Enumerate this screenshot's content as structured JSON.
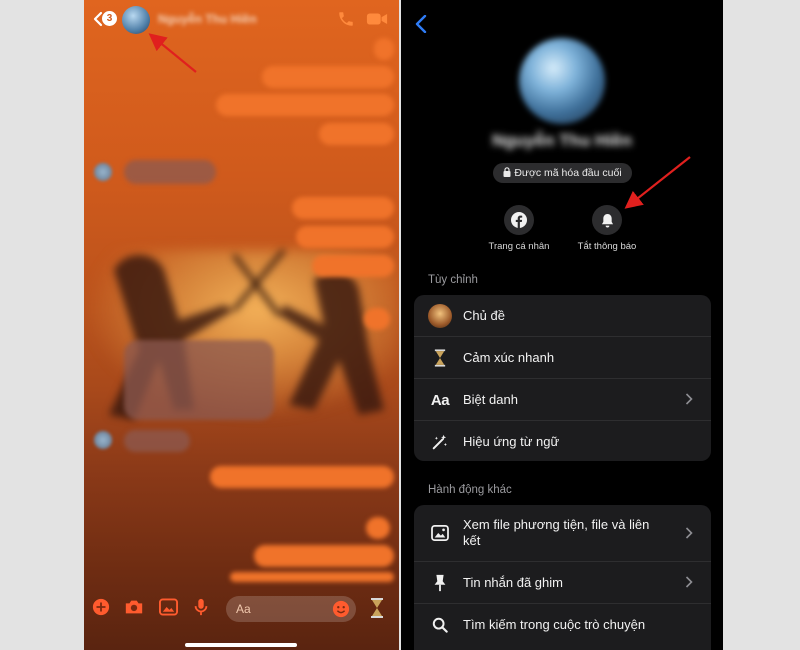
{
  "left_chat": {
    "unread_count": "3",
    "contact_name": "Nguyễn Thu Hiền",
    "composer_placeholder": "Aa",
    "accent_color": "#f0732a"
  },
  "right_info": {
    "contact_name": "Nguyễn Thu Hiền",
    "encryption_label": "Được mã hóa đầu cuối",
    "actions": [
      {
        "label": "Trang cá nhân",
        "icon": "facebook-icon"
      },
      {
        "label": "Tắt thông báo",
        "icon": "bell-icon"
      }
    ],
    "customize_title": "Tùy chỉnh",
    "customize_items": [
      {
        "label": "Chủ đề",
        "icon": "theme-avatar-icon"
      },
      {
        "label": "Cảm xúc nhanh",
        "icon": "hourglass-icon"
      },
      {
        "label": "Biệt danh",
        "icon": "aa-icon"
      },
      {
        "label": "Hiệu ứng từ ngữ",
        "icon": "magic-wand-icon"
      }
    ],
    "other_actions_title": "Hành động khác",
    "other_actions_items": [
      {
        "label": "Xem file phương tiện, file và liên kết",
        "icon": "image-icon"
      },
      {
        "label": "Tin nhắn đã ghim",
        "icon": "pin-icon"
      },
      {
        "label": "Tìm kiếm trong cuộc trò chuyện",
        "icon": "search-icon"
      }
    ]
  },
  "colors": {
    "annotation_arrow": "#e0201e",
    "dark_bg": "#000000",
    "card_bg": "#1c1c1e",
    "ios_blue": "#2f7cf6"
  }
}
